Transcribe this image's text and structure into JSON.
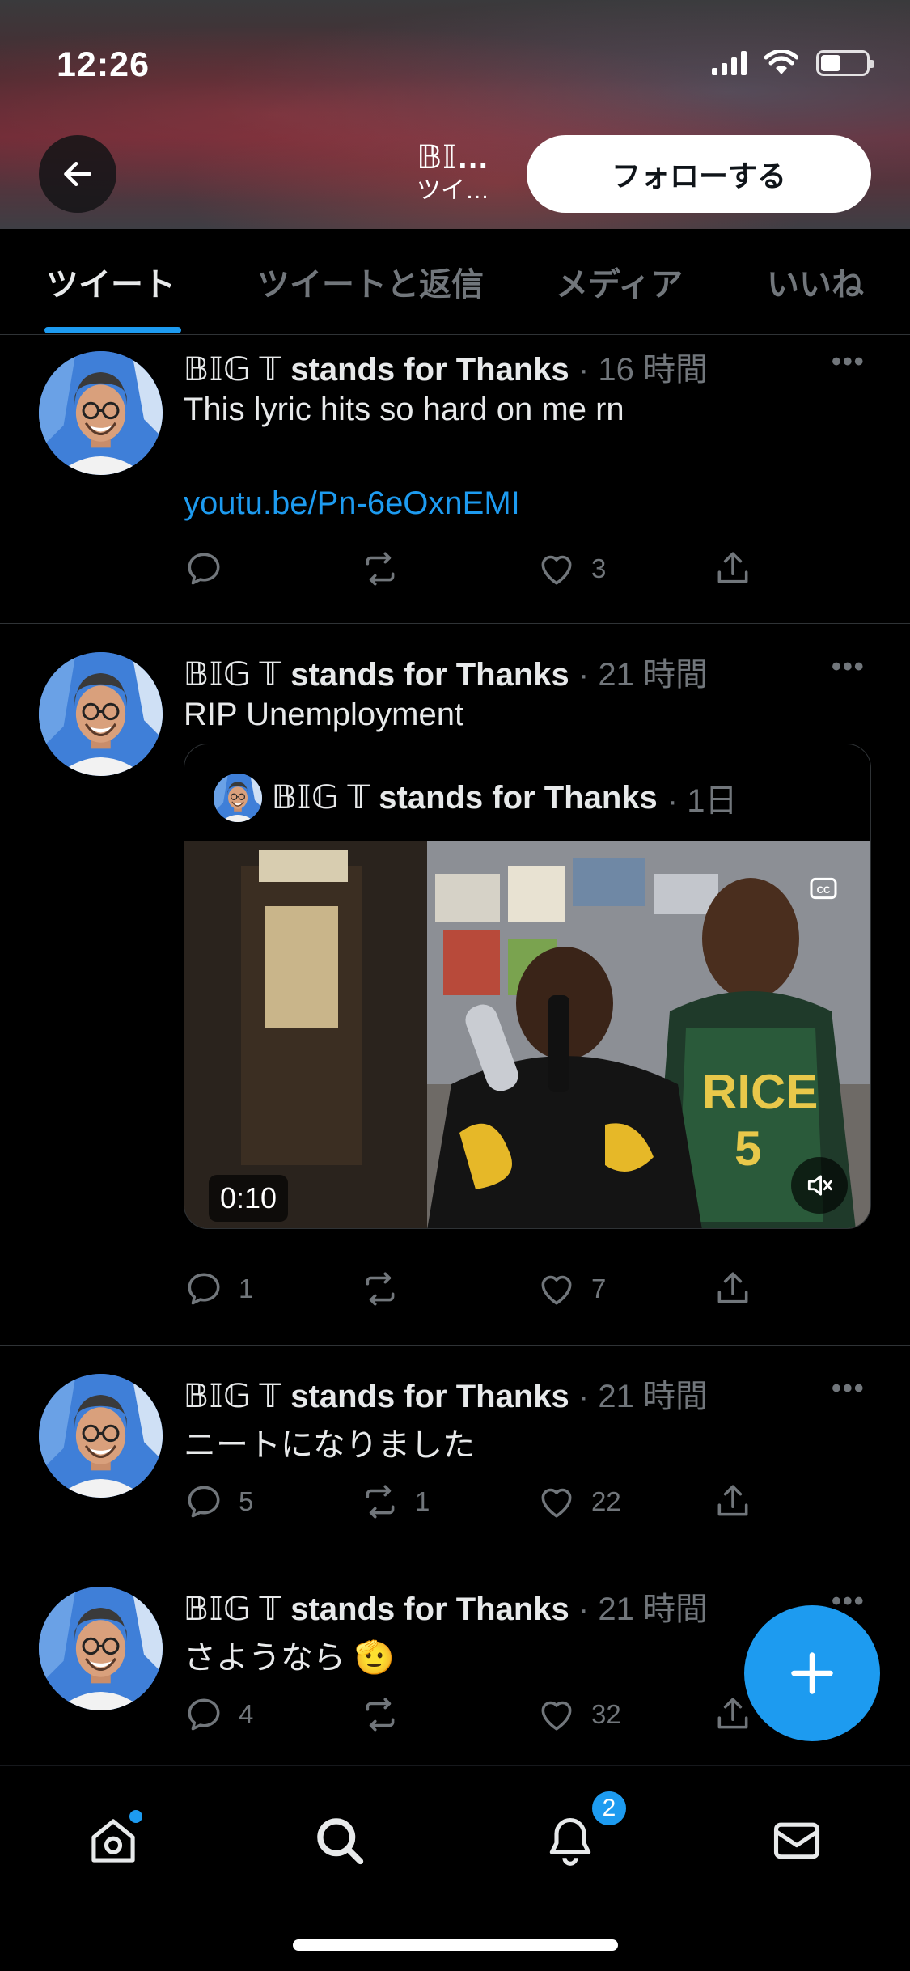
{
  "status_bar": {
    "time": "12:26",
    "battery_level": 0.45
  },
  "header": {
    "title": "𝔹𝕀…",
    "subtitle": "ツイ…",
    "follow_label": "フォローする"
  },
  "tabs": [
    {
      "label": "ツイート",
      "active": true
    },
    {
      "label": "ツイートと返信",
      "active": false
    },
    {
      "label": "メディア",
      "active": false
    },
    {
      "label": "いいね",
      "active": false
    }
  ],
  "tweets": [
    {
      "author": "𝔹𝕀𝔾 𝕋 stands for Thanks",
      "time": "· 16 時間",
      "text": "This lyric hits so hard on me rn",
      "link": "youtu.be/Pn-6eOxnEMI",
      "replies": "",
      "retweets": "",
      "likes": "3"
    },
    {
      "author": "𝔹𝕀𝔾 𝕋 stands for Thanks",
      "time": "· 21 時間",
      "text": "RIP Unemployment",
      "quote": {
        "author": "𝔹𝕀𝔾 𝕋 stands for Thanks",
        "time": "· 1日",
        "duration": "0:10"
      },
      "replies": "1",
      "retweets": "",
      "likes": "7"
    },
    {
      "author": "𝔹𝕀𝔾 𝕋 stands for Thanks",
      "time": "· 21 時間",
      "text": "ニートになりました",
      "replies": "5",
      "retweets": "1",
      "likes": "22"
    },
    {
      "author": "𝔹𝕀𝔾 𝕋 stands for Thanks",
      "time": "· 21 時間",
      "text": "さようなら 🫡",
      "replies": "4",
      "retweets": "",
      "likes": "32"
    }
  ],
  "bottom_nav": {
    "notifications_badge": "2"
  },
  "colors": {
    "accent": "#1d9bf0",
    "background": "#000000",
    "text": "#e7e9ea",
    "muted": "#71767b"
  }
}
